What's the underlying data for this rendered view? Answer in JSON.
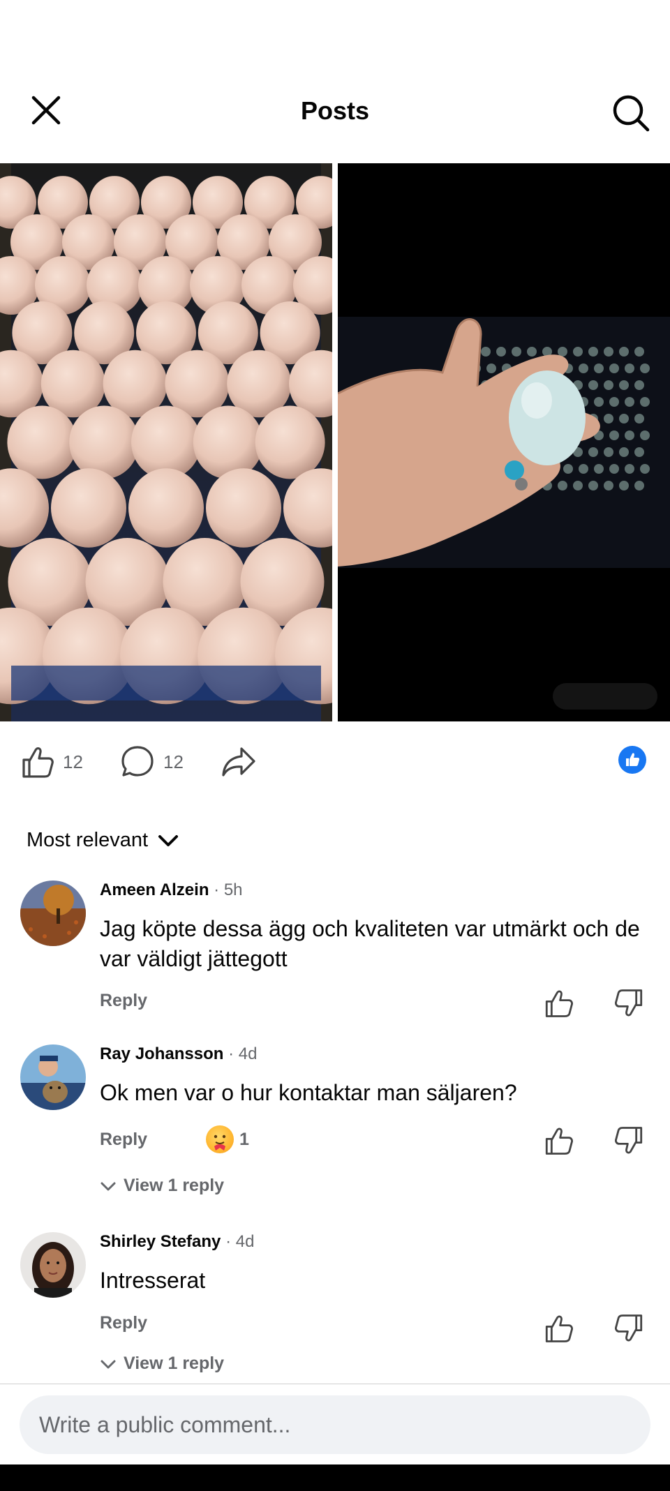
{
  "header": {
    "title": "Posts",
    "close_icon": "close-icon",
    "search_icon": "search-icon"
  },
  "post": {
    "images": [
      {
        "description_icon": "photo-eggs-tray"
      },
      {
        "description_icon": "photo-egg-in-hand"
      }
    ],
    "likes_count": "12",
    "comments_count": "12",
    "reaction_badge_color": "#1877f2"
  },
  "sort": {
    "label": "Most relevant"
  },
  "comments": [
    {
      "name": "Ameen Alzein",
      "time": "· 5h",
      "text": "Jag köpte dessa ägg och kvaliteten var utmärkt och de var väldigt jättegott",
      "reply_label": "Reply"
    },
    {
      "name": "Ray Johansson",
      "time": "· 4d",
      "text": "Ok men var o hur kontaktar man säljaren?",
      "reply_label": "Reply",
      "reaction_count": "1",
      "view_replies": "View 1 reply"
    },
    {
      "name": "Shirley Stefany",
      "time": "· 4d",
      "text": "Intresserat",
      "reply_label": "Reply",
      "view_replies": "View 1 reply"
    }
  ],
  "composer": {
    "placeholder": "Write a public comment..."
  },
  "colors": {
    "accent": "#1877f2",
    "secondary_text": "#65676b",
    "composer_bg": "#f0f2f5"
  }
}
